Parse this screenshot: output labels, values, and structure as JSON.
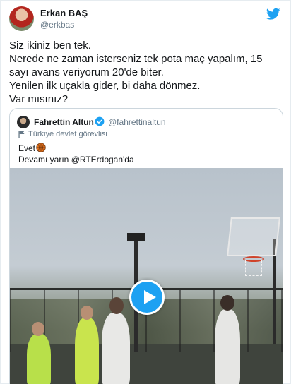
{
  "tweet": {
    "author_name": "Erkan BAŞ",
    "author_handle": "@erkbas",
    "text": "Siz ikiniz ben tek.\nNerede ne zaman isterseniz tek pota maç yapalım, 15 sayı avans veriyorum 20'de biter.\nYenilen ilk uçakla gider, bi daha dönmez.\nVar mısınız?",
    "brand_icon": "twitter-bird-icon",
    "brand_color": "#1da1f2"
  },
  "quote": {
    "author_name": "Fahrettin Altun",
    "author_handle": "@fahrettinaltun",
    "verified_icon": "verified-badge-icon",
    "label_icon": "flag-icon",
    "label": "Türkiye devlet görevlisi",
    "line1": "Evet",
    "line1_emoji": "basketball-icon",
    "line2": "Devamı yarın @RTErdogan'da",
    "media": {
      "type": "video",
      "play_icon": "play-icon",
      "play_color": "#1da1f2"
    }
  }
}
